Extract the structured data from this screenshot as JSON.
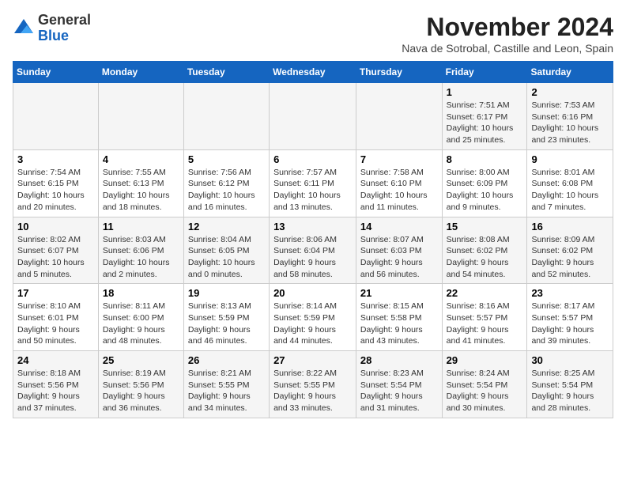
{
  "logo": {
    "text_general": "General",
    "text_blue": "Blue"
  },
  "title": "November 2024",
  "location": "Nava de Sotrobal, Castille and Leon, Spain",
  "days_of_week": [
    "Sunday",
    "Monday",
    "Tuesday",
    "Wednesday",
    "Thursday",
    "Friday",
    "Saturday"
  ],
  "weeks": [
    [
      {
        "day": "",
        "info": ""
      },
      {
        "day": "",
        "info": ""
      },
      {
        "day": "",
        "info": ""
      },
      {
        "day": "",
        "info": ""
      },
      {
        "day": "",
        "info": ""
      },
      {
        "day": "1",
        "info": "Sunrise: 7:51 AM\nSunset: 6:17 PM\nDaylight: 10 hours and 25 minutes."
      },
      {
        "day": "2",
        "info": "Sunrise: 7:53 AM\nSunset: 6:16 PM\nDaylight: 10 hours and 23 minutes."
      }
    ],
    [
      {
        "day": "3",
        "info": "Sunrise: 7:54 AM\nSunset: 6:15 PM\nDaylight: 10 hours and 20 minutes."
      },
      {
        "day": "4",
        "info": "Sunrise: 7:55 AM\nSunset: 6:13 PM\nDaylight: 10 hours and 18 minutes."
      },
      {
        "day": "5",
        "info": "Sunrise: 7:56 AM\nSunset: 6:12 PM\nDaylight: 10 hours and 16 minutes."
      },
      {
        "day": "6",
        "info": "Sunrise: 7:57 AM\nSunset: 6:11 PM\nDaylight: 10 hours and 13 minutes."
      },
      {
        "day": "7",
        "info": "Sunrise: 7:58 AM\nSunset: 6:10 PM\nDaylight: 10 hours and 11 minutes."
      },
      {
        "day": "8",
        "info": "Sunrise: 8:00 AM\nSunset: 6:09 PM\nDaylight: 10 hours and 9 minutes."
      },
      {
        "day": "9",
        "info": "Sunrise: 8:01 AM\nSunset: 6:08 PM\nDaylight: 10 hours and 7 minutes."
      }
    ],
    [
      {
        "day": "10",
        "info": "Sunrise: 8:02 AM\nSunset: 6:07 PM\nDaylight: 10 hours and 5 minutes."
      },
      {
        "day": "11",
        "info": "Sunrise: 8:03 AM\nSunset: 6:06 PM\nDaylight: 10 hours and 2 minutes."
      },
      {
        "day": "12",
        "info": "Sunrise: 8:04 AM\nSunset: 6:05 PM\nDaylight: 10 hours and 0 minutes."
      },
      {
        "day": "13",
        "info": "Sunrise: 8:06 AM\nSunset: 6:04 PM\nDaylight: 9 hours and 58 minutes."
      },
      {
        "day": "14",
        "info": "Sunrise: 8:07 AM\nSunset: 6:03 PM\nDaylight: 9 hours and 56 minutes."
      },
      {
        "day": "15",
        "info": "Sunrise: 8:08 AM\nSunset: 6:02 PM\nDaylight: 9 hours and 54 minutes."
      },
      {
        "day": "16",
        "info": "Sunrise: 8:09 AM\nSunset: 6:02 PM\nDaylight: 9 hours and 52 minutes."
      }
    ],
    [
      {
        "day": "17",
        "info": "Sunrise: 8:10 AM\nSunset: 6:01 PM\nDaylight: 9 hours and 50 minutes."
      },
      {
        "day": "18",
        "info": "Sunrise: 8:11 AM\nSunset: 6:00 PM\nDaylight: 9 hours and 48 minutes."
      },
      {
        "day": "19",
        "info": "Sunrise: 8:13 AM\nSunset: 5:59 PM\nDaylight: 9 hours and 46 minutes."
      },
      {
        "day": "20",
        "info": "Sunrise: 8:14 AM\nSunset: 5:59 PM\nDaylight: 9 hours and 44 minutes."
      },
      {
        "day": "21",
        "info": "Sunrise: 8:15 AM\nSunset: 5:58 PM\nDaylight: 9 hours and 43 minutes."
      },
      {
        "day": "22",
        "info": "Sunrise: 8:16 AM\nSunset: 5:57 PM\nDaylight: 9 hours and 41 minutes."
      },
      {
        "day": "23",
        "info": "Sunrise: 8:17 AM\nSunset: 5:57 PM\nDaylight: 9 hours and 39 minutes."
      }
    ],
    [
      {
        "day": "24",
        "info": "Sunrise: 8:18 AM\nSunset: 5:56 PM\nDaylight: 9 hours and 37 minutes."
      },
      {
        "day": "25",
        "info": "Sunrise: 8:19 AM\nSunset: 5:56 PM\nDaylight: 9 hours and 36 minutes."
      },
      {
        "day": "26",
        "info": "Sunrise: 8:21 AM\nSunset: 5:55 PM\nDaylight: 9 hours and 34 minutes."
      },
      {
        "day": "27",
        "info": "Sunrise: 8:22 AM\nSunset: 5:55 PM\nDaylight: 9 hours and 33 minutes."
      },
      {
        "day": "28",
        "info": "Sunrise: 8:23 AM\nSunset: 5:54 PM\nDaylight: 9 hours and 31 minutes."
      },
      {
        "day": "29",
        "info": "Sunrise: 8:24 AM\nSunset: 5:54 PM\nDaylight: 9 hours and 30 minutes."
      },
      {
        "day": "30",
        "info": "Sunrise: 8:25 AM\nSunset: 5:54 PM\nDaylight: 9 hours and 28 minutes."
      }
    ]
  ]
}
